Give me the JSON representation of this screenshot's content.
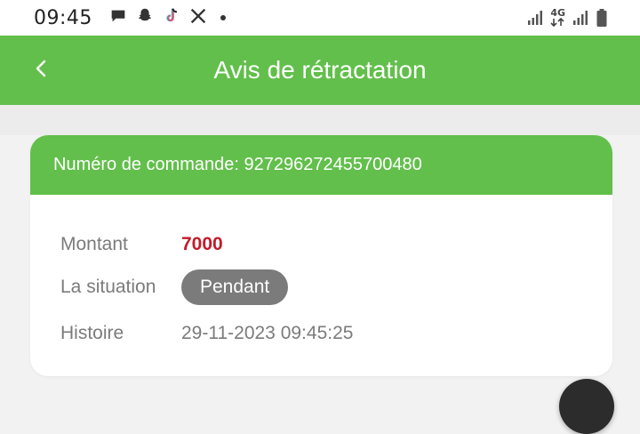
{
  "status_bar": {
    "time": "09:45",
    "network": "4G",
    "left_icons": [
      "chat-bubble-icon",
      "snapchat-icon",
      "tiktok-icon",
      "x-icon",
      "dot-icon"
    ],
    "right_icons": [
      "signal-icon",
      "network-4g-icon",
      "signal-icon",
      "battery-icon"
    ]
  },
  "header": {
    "title": "Avis de rétractation",
    "back_icon": "chevron-left-icon",
    "color": "#62bf4b"
  },
  "order": {
    "header_text": "Numéro de commande: 927296272455700480",
    "rows": {
      "amount": {
        "label": "Montant",
        "value": "7000"
      },
      "status": {
        "label": "La situation",
        "value": "Pendant"
      },
      "history": {
        "label": "Histoire",
        "value": "29-11-2023 09:45:25"
      }
    },
    "colors": {
      "amount": "#c31b2a",
      "pill": "#7b7b7b"
    }
  }
}
